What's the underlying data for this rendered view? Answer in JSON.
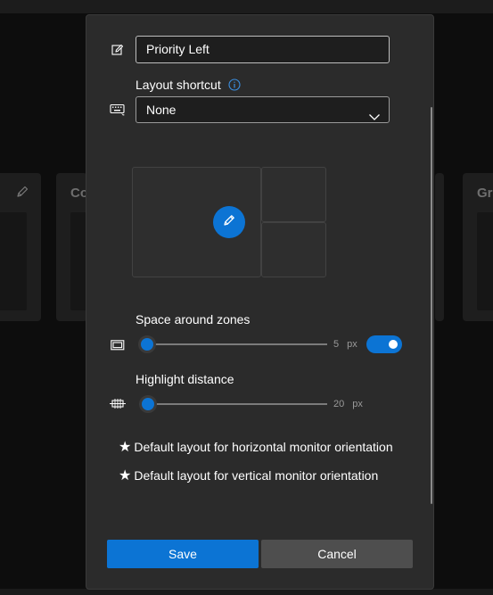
{
  "background": {
    "left_card_pencil": "pencil-icon",
    "card_left_title": "Co",
    "card_right_title": "Gri"
  },
  "dialog": {
    "name_value": "Priority Left",
    "shortcut_label": "Layout shortcut",
    "shortcut_value": "None",
    "space_label": "Space around zones",
    "space_value": "5",
    "space_unit": "px",
    "space_level": 0.0,
    "space_enabled": true,
    "highlight_label": "Highlight distance",
    "highlight_value": "20",
    "highlight_unit": "px",
    "highlight_level": 0.0,
    "default_horizontal": "Default layout for horizontal monitor orientation",
    "default_vertical": "Default layout for vertical monitor orientation",
    "star_glyph": "★",
    "save_label": "Save",
    "cancel_label": "Cancel"
  },
  "colors": {
    "accent": "#0c74d4",
    "dialog_bg": "#2b2b2b",
    "cancel_bg": "#4e4e4e"
  }
}
